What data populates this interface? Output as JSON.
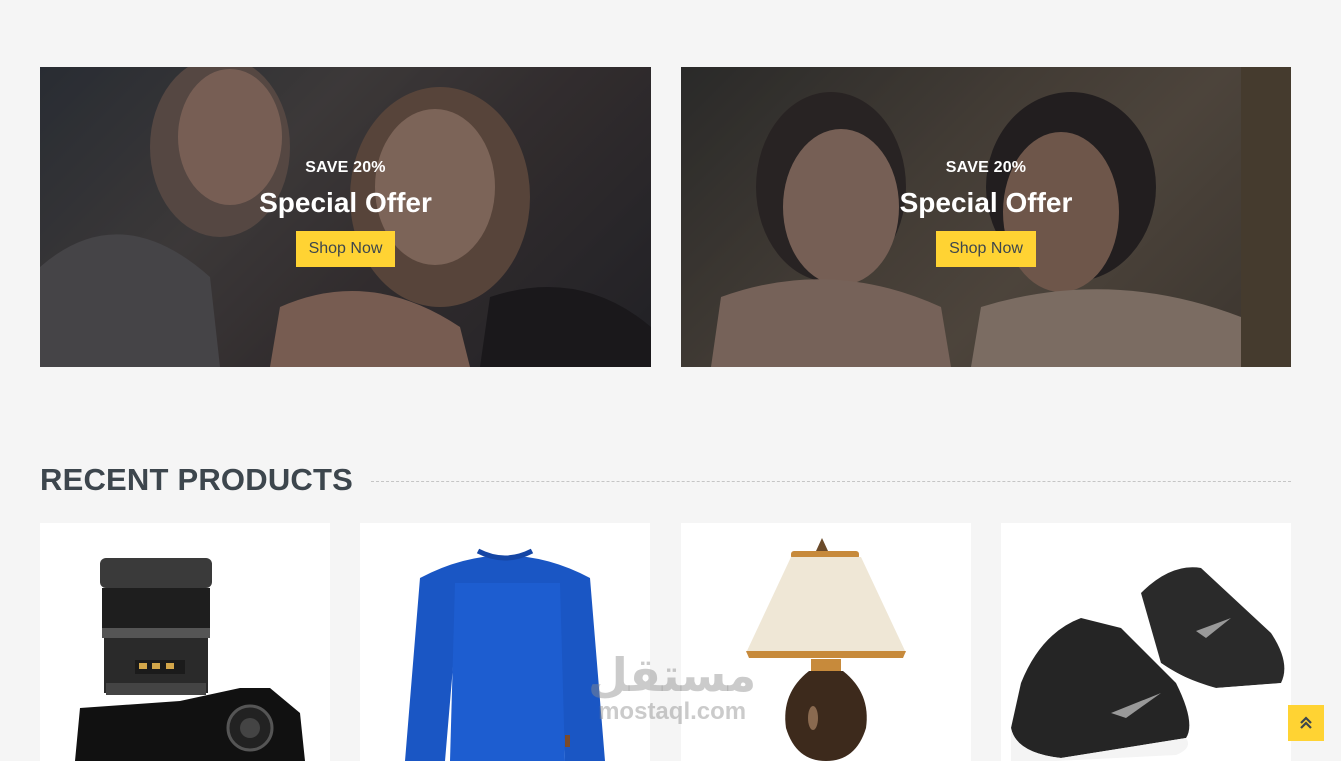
{
  "offers": [
    {
      "save_label": "SAVE 20%",
      "title": "Special Offer",
      "button_label": "Shop Now"
    },
    {
      "save_label": "SAVE 20%",
      "title": "Special Offer",
      "button_label": "Shop Now"
    }
  ],
  "recent_products": {
    "heading": "RECENT PRODUCTS",
    "items": [
      {
        "image": "camera-image"
      },
      {
        "image": "blue-sweater-image"
      },
      {
        "image": "table-lamp-image"
      },
      {
        "image": "sneakers-image"
      }
    ]
  },
  "watermark": {
    "arabic": "مستقل",
    "latin": "mostaql.com"
  },
  "back_to_top": {
    "icon": "double-chevron-up-icon"
  },
  "colors": {
    "accent": "#ffd333",
    "text_dark": "#3d464d",
    "background": "#f5f5f5"
  }
}
